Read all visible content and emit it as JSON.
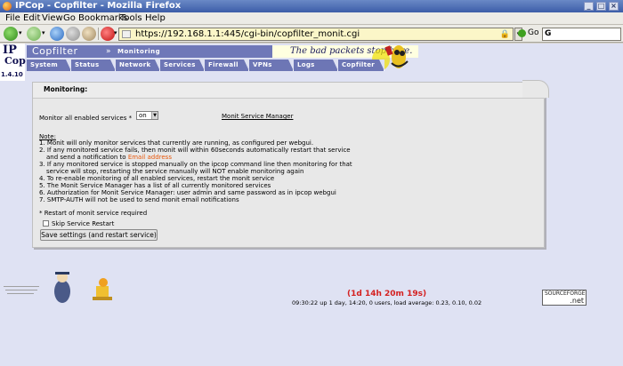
{
  "window": {
    "title": "IPCop - Copfilter - Mozilla Firefox"
  },
  "menu": [
    "File",
    "Edit",
    "View",
    "Go",
    "Bookmarks",
    "Tools",
    "Help"
  ],
  "nav": {
    "url": "https://192.168.1.1:445/cgi-bin/copfilter_monit.cgi",
    "go_label": "Go",
    "search_engine": "G"
  },
  "ipcop": {
    "logo_ip": "IP",
    "logo_cop": "Cop",
    "version": "1.4.10",
    "section": "Copfilter",
    "subsection": "Monitoring",
    "slogan": "The bad packets stop here.",
    "tabs": [
      "System",
      "Status",
      "Network",
      "Services",
      "Firewall",
      "VPNs",
      "Logs",
      "Copfilter"
    ]
  },
  "box": {
    "title": "Monitoring:",
    "monitor_label": "Monitor all enabled services *",
    "monitor_value": "on",
    "monit_link": "Monit Service Manager",
    "note_title": "Note:",
    "notes": [
      "1. Monit will only monitor services that currently are running, as configured per webgui.",
      "2. If any monitored service fails, then monit will within 60seconds automatically restart that service",
      "and send a notification to ",
      "Email address",
      "3. If any monitored service is stopped manually on the ipcop command line then monitoring for that",
      "service will stop, restarting the service manually will NOT enable monitoring again",
      "4. To re-enable monitoring of all enabled services, restart the monit service",
      "5. The Monit Service Manager has a list of all currently monitored services",
      "6. Authorization for Monit Service Manager: user admin and same password as in ipcop webgui",
      "7. SMTP-AUTH will not be used to send monit email notifications"
    ],
    "restart_note": "* Restart of monit service required",
    "skip_label": "Skip Service Restart",
    "save_button": "Save settings (and restart service)"
  },
  "footer": {
    "uptime": "1d 14h 20m 19s",
    "load": "09:30:22 up 1 day, 14:20, 0 users, load average: 0.23, 0.10, 0.02",
    "sf_a": "SOURCEFORGE",
    "sf_b": ".net"
  }
}
